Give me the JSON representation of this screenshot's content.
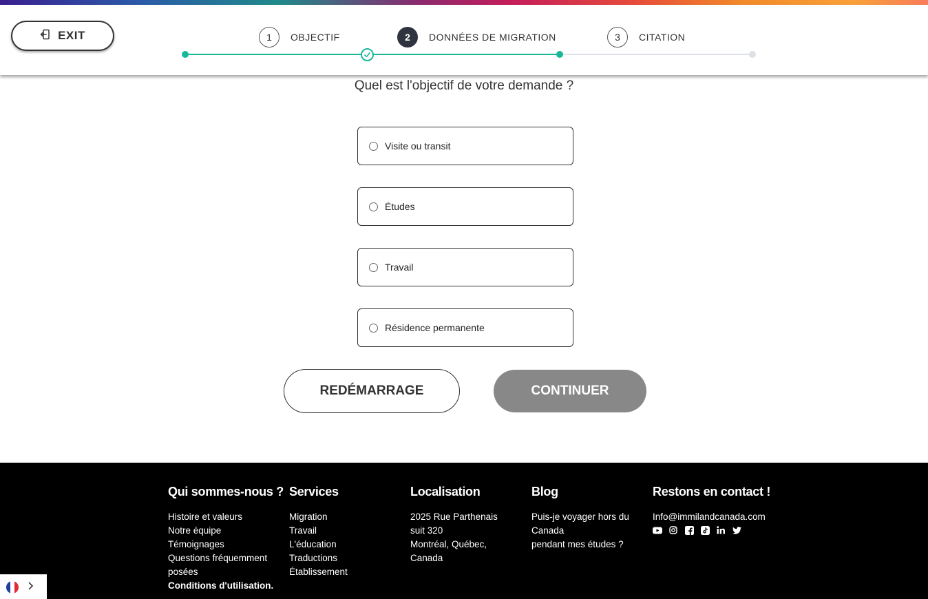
{
  "header": {
    "exit_label": "EXIT",
    "steps": [
      {
        "number": "1",
        "label": "OBJECTIF"
      },
      {
        "number": "2",
        "label": "DONNÉES DE MIGRATION"
      },
      {
        "number": "3",
        "label": "CITATION"
      }
    ],
    "current_step": 2,
    "progress_fraction": 0.66
  },
  "form": {
    "question": "Quel est l'objectif de votre demande ?",
    "options": [
      "Visite ou transit",
      "Études",
      "Travail",
      "Résidence permanente"
    ],
    "restart_label": "REDÉMARRAGE",
    "continue_label": "CONTINUER"
  },
  "footer": {
    "about": {
      "heading": "Qui sommes-nous ?",
      "links": [
        "Histoire et valeurs",
        "Notre équipe",
        "Témoignages",
        "Questions fréquemment",
        "posées",
        "Conditions d'utilisation."
      ]
    },
    "services": {
      "heading": "Services",
      "links": [
        "Migration",
        "Travail",
        "L'éducation",
        "Traductions",
        "Établissement"
      ]
    },
    "location": {
      "heading": "Localisation",
      "lines": [
        "2025 Rue Parthenais",
        "suit 320",
        "Montréal, Québec,",
        "Canada"
      ]
    },
    "blog": {
      "heading": "Blog",
      "lines": [
        "Puis-je voyager hors du",
        "Canada",
        "pendant mes études ?"
      ]
    },
    "contact": {
      "heading": "Restons en contact !",
      "email": "Info@immilandcanada.com",
      "social_icons": [
        "youtube-icon",
        "instagram-icon",
        "facebook-icon",
        "tiktok-icon",
        "linkedin-icon",
        "twitter-icon"
      ]
    }
  },
  "colors": {
    "accent": "#19b89a",
    "active_step": "#2f3440",
    "continue_disabled": "#888888",
    "footer_bg": "#000000"
  },
  "language": {
    "current": "fr",
    "flag_icon": "france-flag-icon"
  }
}
